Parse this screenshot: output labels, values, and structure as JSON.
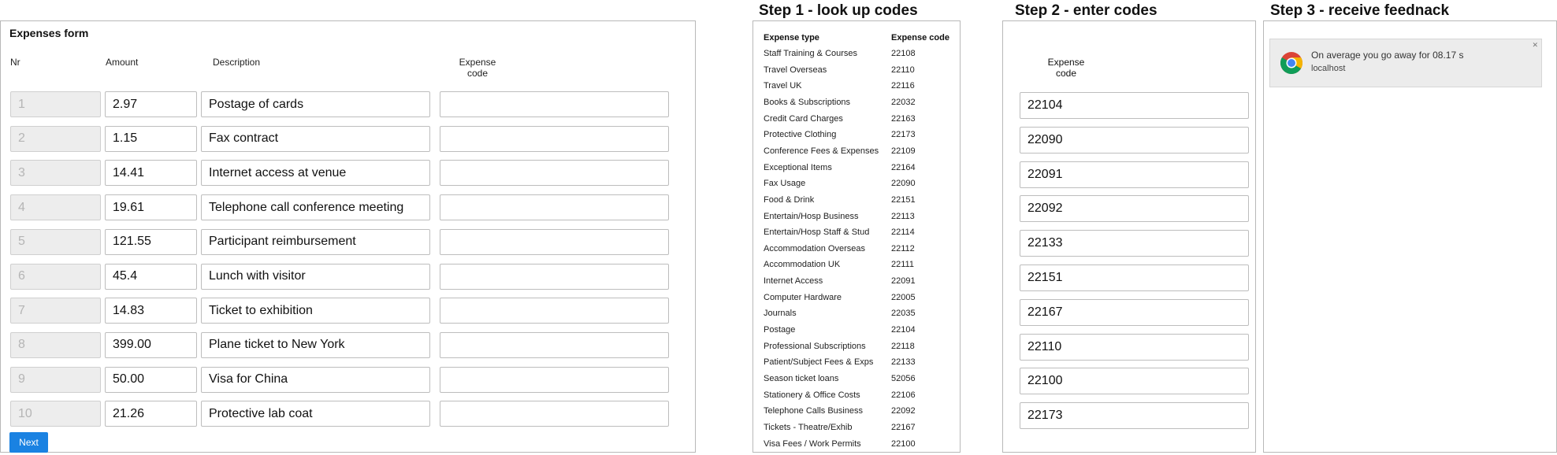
{
  "form": {
    "title": "Expenses form",
    "col_nr": "Nr",
    "col_amount": "Amount",
    "col_description": "Description",
    "col_code_line1": "Expense",
    "col_code_line2": "code",
    "next_label": "Next",
    "rows": [
      {
        "nr": "1",
        "amount": "2.97",
        "description": "Postage of cards",
        "code": ""
      },
      {
        "nr": "2",
        "amount": "1.15",
        "description": "Fax contract",
        "code": ""
      },
      {
        "nr": "3",
        "amount": "14.41",
        "description": "Internet access at venue",
        "code": ""
      },
      {
        "nr": "4",
        "amount": "19.61",
        "description": "Telephone call conference meeting",
        "code": ""
      },
      {
        "nr": "5",
        "amount": "121.55",
        "description": "Participant reimbursement",
        "code": ""
      },
      {
        "nr": "6",
        "amount": "45.4",
        "description": "Lunch with visitor",
        "code": ""
      },
      {
        "nr": "7",
        "amount": "14.83",
        "description": "Ticket to exhibition",
        "code": ""
      },
      {
        "nr": "8",
        "amount": "399.00",
        "description": "Plane ticket to New York",
        "code": ""
      },
      {
        "nr": "9",
        "amount": "50.00",
        "description": "Visa for China",
        "code": ""
      },
      {
        "nr": "10",
        "amount": "21.26",
        "description": "Protective lab coat",
        "code": ""
      }
    ]
  },
  "step1": {
    "title": "Step 1 - look up codes",
    "header_type": "Expense type",
    "header_code": "Expense code",
    "items": [
      {
        "type": "Staff Training & Courses",
        "code": "22108"
      },
      {
        "type": "Travel Overseas",
        "code": "22110"
      },
      {
        "type": "Travel UK",
        "code": "22116"
      },
      {
        "type": "Books & Subscriptions",
        "code": "22032"
      },
      {
        "type": "Credit Card Charges",
        "code": "22163"
      },
      {
        "type": "Protective Clothing",
        "code": "22173"
      },
      {
        "type": "Conference Fees & Expenses",
        "code": "22109"
      },
      {
        "type": "Exceptional Items",
        "code": "22164"
      },
      {
        "type": "Fax Usage",
        "code": "22090"
      },
      {
        "type": "Food & Drink",
        "code": "22151"
      },
      {
        "type": "Entertain/Hosp Business",
        "code": "22113"
      },
      {
        "type": "Entertain/Hosp Staff & Stud",
        "code": "22114"
      },
      {
        "type": "Accommodation Overseas",
        "code": "22112"
      },
      {
        "type": "Accommodation UK",
        "code": "22111"
      },
      {
        "type": "Internet Access",
        "code": "22091"
      },
      {
        "type": "Computer Hardware",
        "code": "22005"
      },
      {
        "type": "Journals",
        "code": "22035"
      },
      {
        "type": "Postage",
        "code": "22104"
      },
      {
        "type": "Professional Subscriptions",
        "code": "22118"
      },
      {
        "type": "Patient/Subject Fees & Exps",
        "code": "22133"
      },
      {
        "type": "Season ticket loans",
        "code": "52056"
      },
      {
        "type": "Stationery & Office Costs",
        "code": "22106"
      },
      {
        "type": "Telephone Calls Business",
        "code": "22092"
      },
      {
        "type": "Tickets - Theatre/Exhib",
        "code": "22167"
      },
      {
        "type": "Visa Fees / Work Permits",
        "code": "22100"
      }
    ]
  },
  "step2": {
    "title": "Step 2 - enter codes",
    "header_line1": "Expense",
    "header_line2": "code",
    "codes": [
      "22104",
      "22090",
      "22091",
      "22092",
      "22133",
      "22151",
      "22167",
      "22110",
      "22100",
      "22173"
    ]
  },
  "step3": {
    "title": "Step 3 - receive feednack",
    "message": "On average you go away for 08.17   s",
    "source": "localhost",
    "icon": "chrome-icon"
  },
  "colors": {
    "accent": "#1a82e2",
    "border": "#bdbdbd",
    "disabled_bg": "#ededed"
  }
}
